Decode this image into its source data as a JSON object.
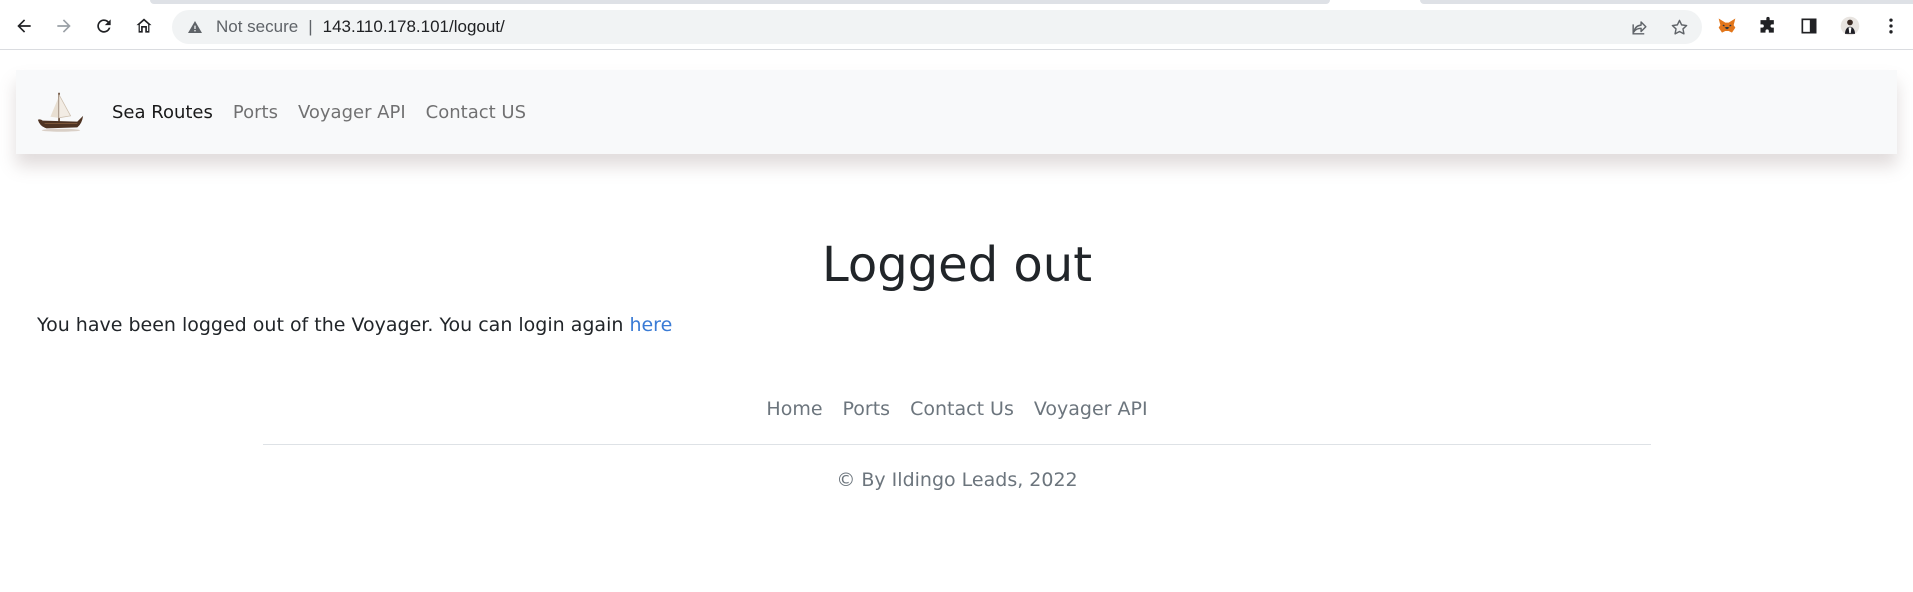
{
  "browser": {
    "security_label": "Not secure",
    "separator": "|",
    "url": "143.110.178.101/logout/"
  },
  "navbar": {
    "links": [
      {
        "label": "Sea Routes"
      },
      {
        "label": "Ports"
      },
      {
        "label": "Voyager API"
      },
      {
        "label": "Contact US"
      }
    ]
  },
  "main": {
    "title": "Logged out",
    "message": "You have been logged out of the Voyager. You can login again",
    "link_text": "here"
  },
  "footer": {
    "links": [
      {
        "label": "Home"
      },
      {
        "label": "Ports"
      },
      {
        "label": "Contact Us"
      },
      {
        "label": "Voyager API"
      }
    ],
    "copyright": "© By Ildingo Leads, 2022"
  },
  "colors": {
    "link": "#3a7bd5",
    "nav_bg": "#f8f9fa",
    "text": "#212529",
    "muted": "#6c757d"
  },
  "icons": [
    "back-icon",
    "forward-icon",
    "reload-icon",
    "home-icon",
    "warning-icon",
    "share-icon",
    "bookmark-star-icon",
    "fox-extension-icon",
    "puzzle-extensions-icon",
    "sidebar-icon",
    "profile-avatar",
    "kebab-menu-icon",
    "ship-logo-icon"
  ]
}
